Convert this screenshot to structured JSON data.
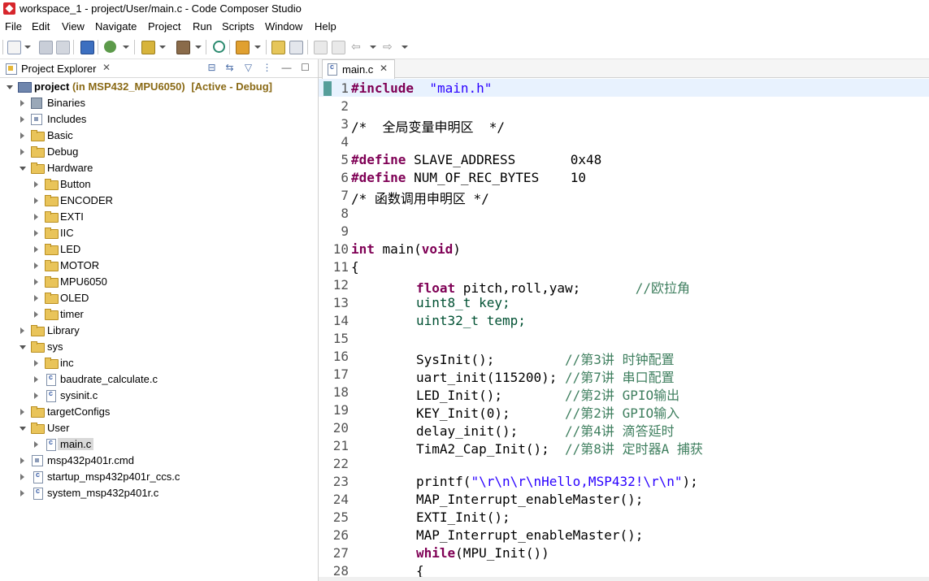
{
  "window": {
    "title": "workspace_1 - project/User/main.c - Code Composer Studio"
  },
  "menu": [
    "File",
    "Edit",
    "View",
    "Navigate",
    "Project",
    "Run",
    "Scripts",
    "Window",
    "Help"
  ],
  "explorer": {
    "tab_label": "Project Explorer",
    "tab_close": "✕",
    "project": {
      "name": "project",
      "extra": "(in MSP432_MPU6050)",
      "status": "[Active - Debug]"
    },
    "items": [
      {
        "label": "Binaries",
        "icon": "binaries-icon"
      },
      {
        "label": "Includes",
        "icon": "includes-icon"
      },
      {
        "label": "Basic",
        "icon": "folder-icon"
      },
      {
        "label": "Debug",
        "icon": "folder-icon"
      },
      {
        "label": "Hardware",
        "icon": "folder-icon"
      },
      {
        "label": "Button",
        "icon": "folder-icon"
      },
      {
        "label": "ENCODER",
        "icon": "folder-icon"
      },
      {
        "label": "EXTI",
        "icon": "folder-icon"
      },
      {
        "label": "IIC",
        "icon": "folder-icon"
      },
      {
        "label": "LED",
        "icon": "folder-icon"
      },
      {
        "label": "MOTOR",
        "icon": "folder-icon"
      },
      {
        "label": "MPU6050",
        "icon": "folder-icon"
      },
      {
        "label": "OLED",
        "icon": "folder-icon"
      },
      {
        "label": "timer",
        "icon": "folder-icon"
      },
      {
        "label": "Library",
        "icon": "folder-icon"
      },
      {
        "label": "sys",
        "icon": "folder-icon"
      },
      {
        "label": "inc",
        "icon": "folder-icon"
      },
      {
        "label": "baudrate_calculate.c",
        "icon": "c-file-icon"
      },
      {
        "label": "sysinit.c",
        "icon": "c-file-icon"
      },
      {
        "label": "targetConfigs",
        "icon": "folder-icon"
      },
      {
        "label": "User",
        "icon": "folder-icon"
      },
      {
        "label": "main.c",
        "icon": "c-file-icon"
      },
      {
        "label": "msp432p401r.cmd",
        "icon": "file-icon"
      },
      {
        "label": "startup_msp432p401r_ccs.c",
        "icon": "c-file-icon"
      },
      {
        "label": "system_msp432p401r.c",
        "icon": "c-file-icon"
      }
    ]
  },
  "editor": {
    "tab_label": "main.c",
    "tab_close": "✕",
    "lines": [
      {
        "n": "1"
      },
      {
        "n": "2"
      },
      {
        "n": "3"
      },
      {
        "n": "4"
      },
      {
        "n": "5"
      },
      {
        "n": "6"
      },
      {
        "n": "7"
      },
      {
        "n": "8"
      },
      {
        "n": "9"
      },
      {
        "n": "10"
      },
      {
        "n": "11"
      },
      {
        "n": "12"
      },
      {
        "n": "13"
      },
      {
        "n": "14"
      },
      {
        "n": "15"
      },
      {
        "n": "16"
      },
      {
        "n": "17"
      },
      {
        "n": "18"
      },
      {
        "n": "19"
      },
      {
        "n": "20"
      },
      {
        "n": "21"
      },
      {
        "n": "22"
      },
      {
        "n": "23"
      },
      {
        "n": "24"
      },
      {
        "n": "25"
      },
      {
        "n": "26"
      },
      {
        "n": "27"
      },
      {
        "n": "28"
      }
    ],
    "code": {
      "l1_kw": "#include",
      "l1_str": "\"main.h\"",
      "l3_cmt": "/*  全局变量申明区  */",
      "l5_kw": "#define",
      "l5_txt": " SLAVE_ADDRESS       0x48",
      "l6_kw": "#define",
      "l6_txt": " NUM_OF_REC_BYTES    10",
      "l7_cmt": "/* 函数调用申明区 */",
      "l10_kw1": "int",
      "l10_txt1": " main(",
      "l10_kw2": "void",
      "l10_txt2": ")",
      "l11_txt": "{",
      "l12_kw": "float",
      "l12_txt": " pitch,roll,yaw;       ",
      "l12_cmt": "//欧拉角",
      "l13_txt": "uint8_t key;",
      "l14_txt": "uint32_t temp;",
      "l16_txt": "SysInit();         ",
      "l16_cmt": "//第3讲 时钟配置",
      "l17_txt": "uart_init(115200); ",
      "l17_cmt": "//第7讲 串口配置",
      "l18_txt": "LED_Init();        ",
      "l18_cmt": "//第2讲 GPIO输出",
      "l19_txt": "KEY_Init(0);       ",
      "l19_cmt": "//第2讲 GPIO输入",
      "l20_txt": "delay_init();      ",
      "l20_cmt": "//第4讲 滴答延时",
      "l21_txt": "TimA2_Cap_Init();  ",
      "l21_cmt": "//第8讲 定时器A 捕获",
      "l23_txt1": "printf(",
      "l23_str": "\"\\r\\n\\r\\nHello,MSP432!\\r\\n\"",
      "l23_txt2": ");",
      "l24_txt": "MAP_Interrupt_enableMaster();",
      "l25_txt": "EXTI_Init();",
      "l26_txt": "MAP_Interrupt_enableMaster();",
      "l27_kw": "while",
      "l27_txt": "(MPU_Init())",
      "l28_txt": "{"
    }
  },
  "colors": {
    "keyword": "#7f0055",
    "string": "#2a00ff",
    "comment": "#3f7f5f",
    "current_line": "#e8f2fe"
  }
}
